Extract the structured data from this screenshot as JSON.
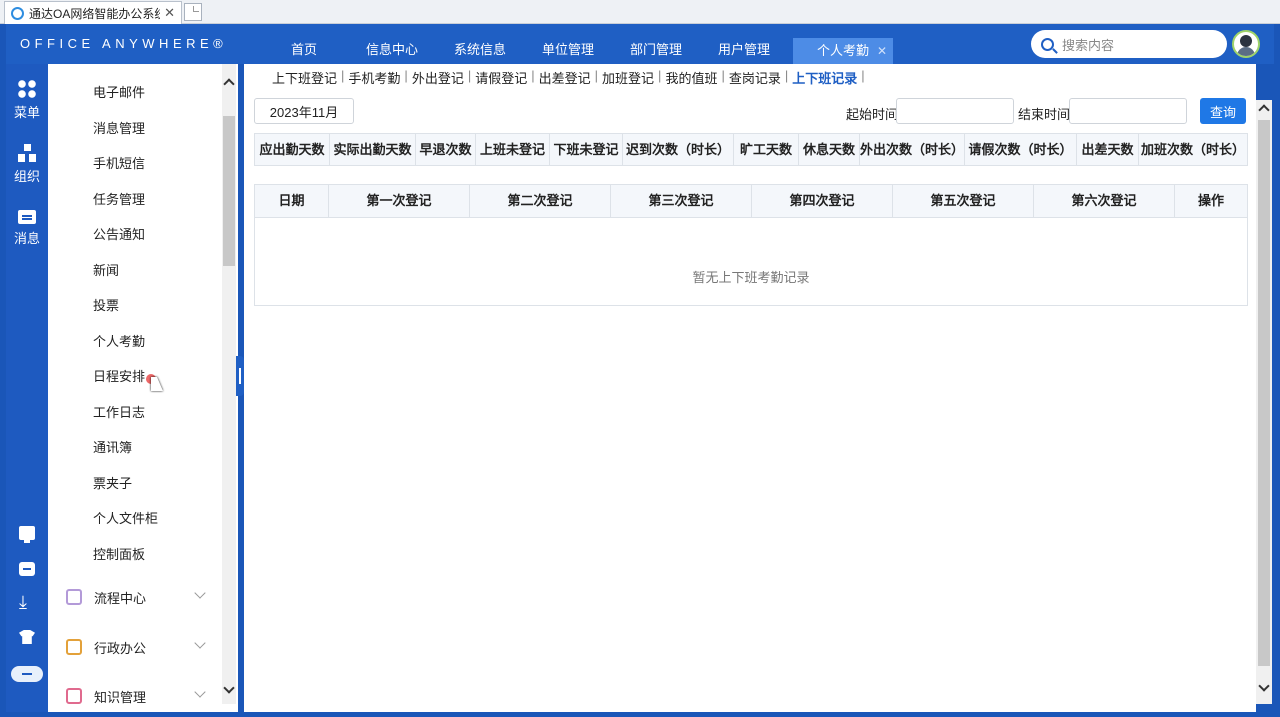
{
  "browser": {
    "tab_title": "通达OA网络智能办公系统",
    "close": "✕"
  },
  "header": {
    "logo": "OFFICE ANYWHERE®",
    "nav": [
      "首页",
      "信息中心",
      "系统信息",
      "单位管理",
      "部门管理",
      "用户管理"
    ],
    "active_tab": "个人考勤",
    "active_tab_close": "✕",
    "search_placeholder": "搜索内容"
  },
  "rail": {
    "items": [
      "菜单",
      "组织",
      "消息"
    ]
  },
  "menu": {
    "items": [
      "电子邮件",
      "消息管理",
      "手机短信",
      "任务管理",
      "公告通知",
      "新闻",
      "投票",
      "个人考勤",
      "日程安排",
      "工作日志",
      "通讯簿",
      "票夹子",
      "个人文件柜",
      "控制面板"
    ],
    "groups": [
      "流程中心",
      "行政办公",
      "知识管理"
    ]
  },
  "subtabs": {
    "items": [
      "上下班登记",
      "手机考勤",
      "外出登记",
      "请假登记",
      "出差登记",
      "加班登记",
      "我的值班",
      "查岗记录",
      "上下班记录"
    ],
    "active_index": 8,
    "separator": "|"
  },
  "filters": {
    "month": "2023年11月",
    "start_label": "起始时间",
    "end_label": "结束时间",
    "query_button": "查询"
  },
  "stats_headers": [
    "应出勤天数",
    "实际出勤天数",
    "早退次数",
    "上班未登记",
    "下班未登记",
    "迟到次数（时长）",
    "旷工天数",
    "休息天数",
    "外出次数（时长）",
    "请假次数（时长）",
    "出差天数",
    "加班次数（时长）"
  ],
  "table": {
    "headers": [
      "日期",
      "第一次登记",
      "第二次登记",
      "第三次登记",
      "第四次登记",
      "第五次登记",
      "第六次登记",
      "操作"
    ],
    "empty_text": "暂无上下班考勤记录"
  },
  "colors": {
    "brand": "#1f5fc4",
    "accent": "#1f78e6"
  }
}
